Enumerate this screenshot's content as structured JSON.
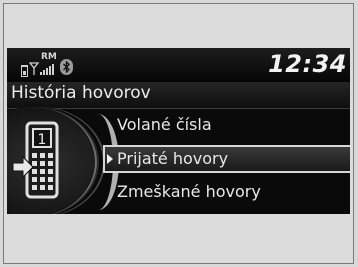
{
  "status": {
    "roaming_label": "RM",
    "clock": "12:34",
    "icons": [
      "battery-icon",
      "signal-strength-icon",
      "bluetooth-icon"
    ]
  },
  "title": "História hovorov",
  "menu": {
    "items": [
      {
        "label": "Volané čísla",
        "selected": false
      },
      {
        "label": "Prijaté hovory",
        "selected": true
      },
      {
        "label": "Zmeškané hovory",
        "selected": false
      }
    ]
  },
  "phone_badge": "1",
  "colors": {
    "screen_bg": "#0b0b0b",
    "text": "#e8e8e8",
    "highlight_border": "#d6d6d6",
    "page_bg": "#d8d8d8"
  }
}
